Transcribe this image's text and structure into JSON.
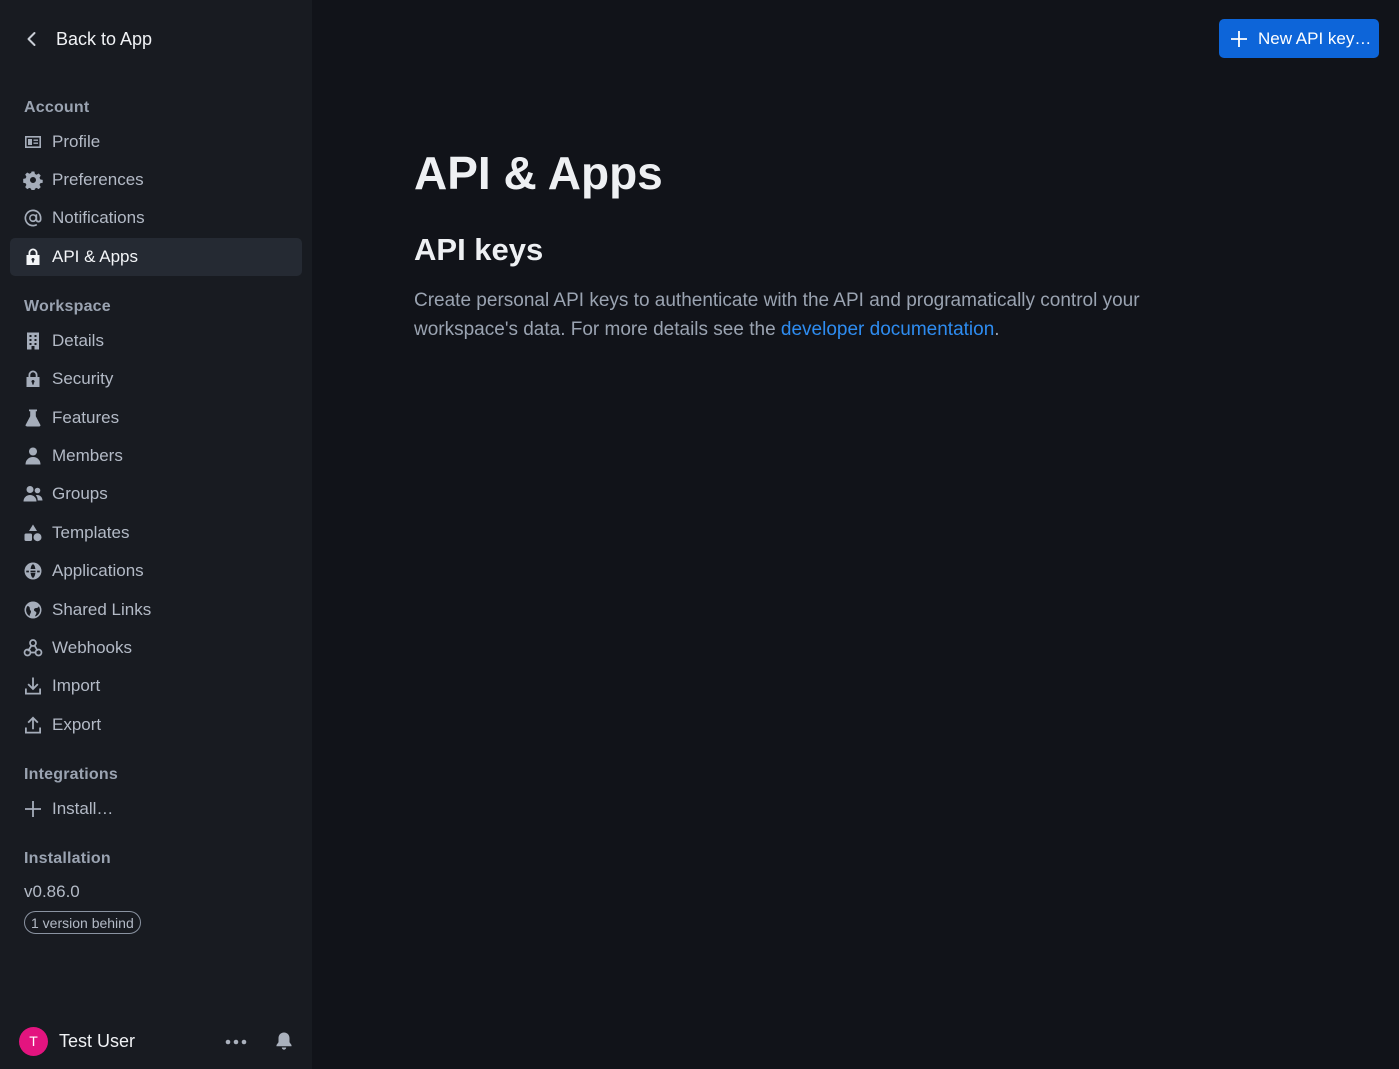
{
  "sidebar": {
    "back_label": "Back to App",
    "sections": {
      "account": "Account",
      "workspace": "Workspace",
      "integrations": "Integrations",
      "installation": "Installation"
    },
    "account_items": [
      {
        "label": "Profile",
        "icon": "profile-card-icon"
      },
      {
        "label": "Preferences",
        "icon": "gear-icon"
      },
      {
        "label": "Notifications",
        "icon": "at-sign-icon"
      },
      {
        "label": "API & Apps",
        "icon": "padlock-icon",
        "active": true
      }
    ],
    "workspace_items": [
      {
        "label": "Details",
        "icon": "building-icon"
      },
      {
        "label": "Security",
        "icon": "padlock-icon"
      },
      {
        "label": "Features",
        "icon": "beaker-icon"
      },
      {
        "label": "Members",
        "icon": "user-icon"
      },
      {
        "label": "Groups",
        "icon": "group-icon"
      },
      {
        "label": "Templates",
        "icon": "shapes-icon"
      },
      {
        "label": "Applications",
        "icon": "globe-icon"
      },
      {
        "label": "Shared Links",
        "icon": "earth-icon"
      },
      {
        "label": "Webhooks",
        "icon": "webhook-icon"
      },
      {
        "label": "Import",
        "icon": "download-icon"
      },
      {
        "label": "Export",
        "icon": "upload-icon"
      }
    ],
    "integration_items": [
      {
        "label": "Install…",
        "icon": "plus-icon"
      }
    ],
    "installation": {
      "version": "v0.86.0",
      "badge": "1 version behind"
    },
    "user": {
      "initial": "T",
      "name": "Test User",
      "avatar_color": "#e3147f"
    }
  },
  "header": {
    "new_button_label": "New API key…"
  },
  "main": {
    "title": "API & Apps",
    "section_title": "API keys",
    "description_before": "Create personal API keys to authenticate with the API and programatically control your workspace's data. For more details see the ",
    "description_link": "developer documentation",
    "description_after": "."
  },
  "colors": {
    "accent": "#0d65d9",
    "link": "#2e8cf0",
    "sidebar_bg": "#181b21",
    "main_bg": "#111319"
  }
}
